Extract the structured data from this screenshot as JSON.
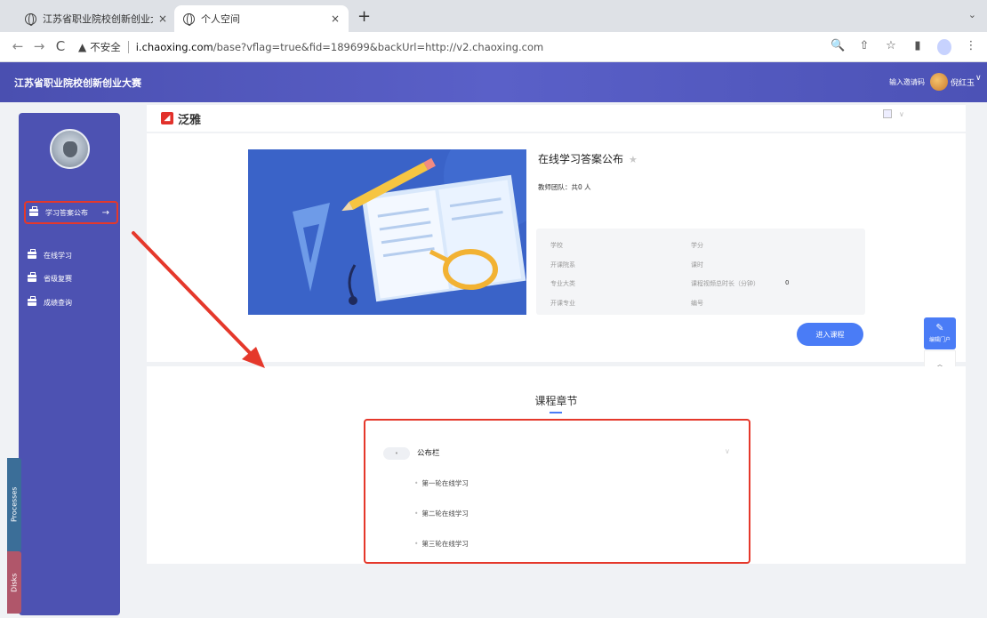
{
  "browser": {
    "tabs": [
      {
        "title": "江苏省职业院校创新创业大赛",
        "close": "×"
      },
      {
        "title": "个人空间",
        "close": "×"
      }
    ],
    "new_tab": "+",
    "tab_menu": "⌄",
    "nav": {
      "back": "←",
      "forward": "→",
      "reload": "C"
    },
    "security": {
      "warning_icon": "▲",
      "label": "不安全"
    },
    "url_host": "i.chaoxing.com",
    "url_rest": "/base?vflag=true&fid=189699&backUrl=http://v2.chaoxing.com",
    "toolbar_icons": {
      "zoom": "🔍",
      "share": "⇧",
      "bookmark": "☆",
      "sidepanel": "▮",
      "menu": "⋮"
    }
  },
  "site": {
    "title": "江苏省职业院校创新创业大赛",
    "invite_code": "输入邀请码",
    "user_name": "倪红玉",
    "user_caret": "∨"
  },
  "sidebar": {
    "items": [
      {
        "label": "学习答案公布",
        "arrow": "→"
      },
      {
        "label": "在线学习"
      },
      {
        "label": "省级复赛"
      },
      {
        "label": "成绩查询"
      }
    ]
  },
  "side_tabs": {
    "processes": "Processes",
    "disks": "Disks"
  },
  "header": {
    "logo_text": "泛雅",
    "logo_mark": "◢",
    "caret": "∨"
  },
  "course": {
    "name": "在线学习答案公布",
    "star": "★",
    "team_label": "教师团队：",
    "team_value": "共0 人",
    "info": {
      "school": "学校",
      "department": "开课院系",
      "major_category": "专业大类",
      "major": "开课专业",
      "credits": "学分",
      "hours": "课时",
      "video_length": "课程视频总时长（分钟）",
      "video_length_value": "0",
      "number": "编号"
    },
    "enter_button": "进入课程"
  },
  "floats": {
    "edit_label": "编辑门户",
    "edit_icon": "✎",
    "up_icon": "︿"
  },
  "chapters": {
    "title": "课程章节",
    "section_badge": "•",
    "section_title": "公布栏",
    "section_caret": "∨",
    "lessons": [
      "第一轮在线学习",
      "第二轮在线学习",
      "第三轮在线学习"
    ]
  },
  "colors": {
    "header": "#4d52b2",
    "accent": "#4a7cf6",
    "annotation": "#e5382b"
  }
}
